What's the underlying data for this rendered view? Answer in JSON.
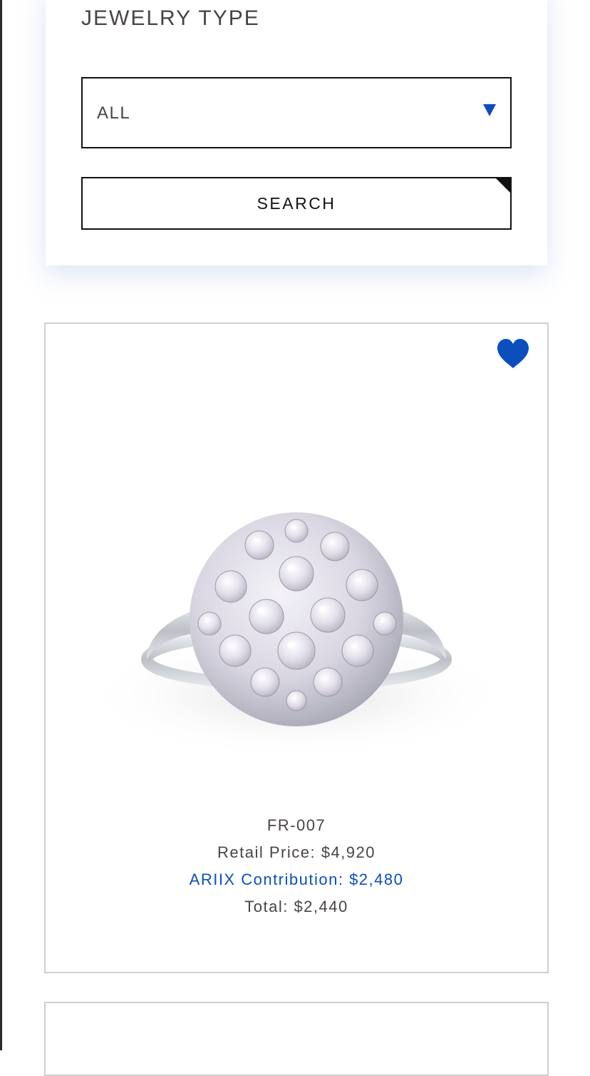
{
  "filter": {
    "title": "JEWELRY TYPE",
    "select_value": "ALL",
    "search_label": "SEARCH"
  },
  "product": {
    "code": "FR-007",
    "retail_price": "Retail Price: $4,920",
    "contribution": "ARIIX Contribution: $2,480",
    "total": "Total: $2,440",
    "favorite_icon": "heart-icon"
  },
  "colors": {
    "accent": "#0b4fbd",
    "text": "#4a4346",
    "border": "#111111",
    "card_border": "#cfcfcf"
  }
}
